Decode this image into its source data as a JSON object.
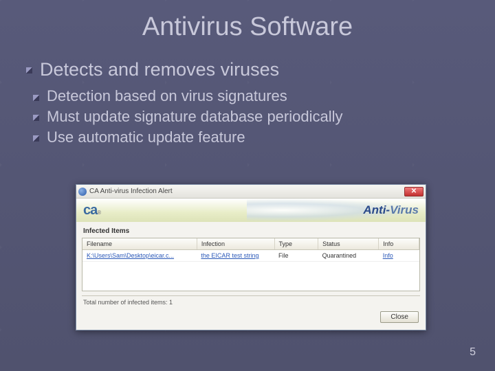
{
  "title": "Antivirus Software",
  "bullets": {
    "b1": "Detects and removes viruses",
    "b2": "Detection based on virus signatures",
    "b3": "Must update signature database periodically",
    "b4": "Use automatic update feature"
  },
  "dialog": {
    "titlebar": "CA Anti-virus Infection Alert",
    "logo_left": "ca",
    "logo_right_a": "Anti-",
    "logo_right_b": "Virus",
    "section": "Infected Items",
    "headers": {
      "file": "Filename",
      "infection": "Infection",
      "type": "Type",
      "status": "Status",
      "info": "Info"
    },
    "row": {
      "file": "K:\\Users\\Sam\\Desktop\\eicar.c...",
      "infection": "the EICAR test string",
      "type": "File",
      "status": "Quarantined",
      "info": "Info"
    },
    "total": "Total number of infected items: 1",
    "close": "Close"
  },
  "page": "5"
}
